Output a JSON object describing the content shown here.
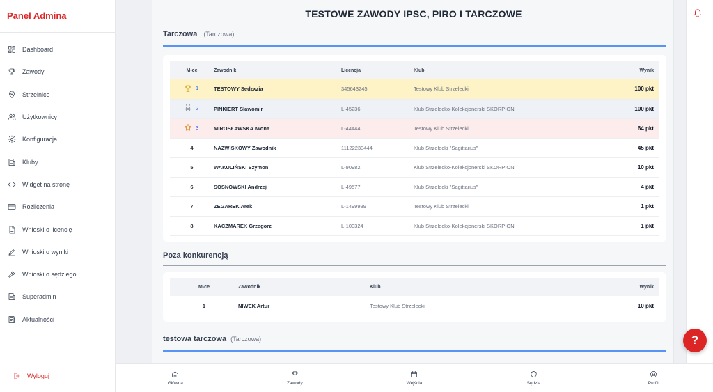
{
  "sidebar": {
    "brand": "Panel Admina",
    "items": [
      {
        "label": "Dashboard",
        "icon": "dashboard-icon"
      },
      {
        "label": "Zawody",
        "icon": "trophy-icon"
      },
      {
        "label": "Strzelnice",
        "icon": "map-pin-icon"
      },
      {
        "label": "Użytkownicy",
        "icon": "users-icon"
      },
      {
        "label": "Konfiguracja",
        "icon": "gear-icon"
      },
      {
        "label": "Kluby",
        "icon": "building-icon"
      },
      {
        "label": "Widget na stronę",
        "icon": "code-icon"
      },
      {
        "label": "Rozliczenia",
        "icon": "credit-card-icon"
      },
      {
        "label": "Wnioski o licencję",
        "icon": "document-icon"
      },
      {
        "label": "Wnioski o wyniki",
        "icon": "pencil-icon"
      },
      {
        "label": "Wnioski o sędziego",
        "icon": "gavel-icon"
      },
      {
        "label": "Superadmin",
        "icon": "building-icon"
      },
      {
        "label": "Aktualności",
        "icon": "newspaper-icon"
      }
    ],
    "logout": "Wyloguj"
  },
  "page": {
    "title": "TESTOWE ZAWODY IPSC, PIRO I TARCZOWE"
  },
  "section1": {
    "title": "Tarczowa",
    "subtitle": "(Tarczowa)",
    "headers": {
      "pos": "M-ce",
      "name": "Zawodnik",
      "license": "Licencja",
      "club": "Klub",
      "result": "Wynik"
    },
    "rows": [
      {
        "pos": "1",
        "name": "TESTOWY Sedzxzia",
        "license": "345643245",
        "club": "Testowy Klub Strzelecki",
        "result": "100 pkt"
      },
      {
        "pos": "2",
        "name": "PINKIERT Sławomir",
        "license": "L-45236",
        "club": "Klub Strzelecko-Kolekcjonerski SKORPION",
        "result": "100 pkt"
      },
      {
        "pos": "3",
        "name": "MIROSŁAWSKA Iwona",
        "license": "L-44444",
        "club": "Testowy Klub Strzelecki",
        "result": "64 pkt"
      },
      {
        "pos": "4",
        "name": "NAZWISKOWY Zawodnik",
        "license": "11122233444",
        "club": "Klub Strzelecki \"Sagittarius\"",
        "result": "45 pkt"
      },
      {
        "pos": "5",
        "name": "WAKULIŃSKI Szymon",
        "license": "L-90982",
        "club": "Klub Strzelecko-Kolekcjonerski SKORPION",
        "result": "10 pkt"
      },
      {
        "pos": "6",
        "name": "SOSNOWSKI Andrzej",
        "license": "L-49577",
        "club": "Klub Strzelecki \"Sagittarius\"",
        "result": "4 pkt"
      },
      {
        "pos": "7",
        "name": "ZEGAREK Arek",
        "license": "L-1499999",
        "club": "Testowy Klub Strzelecki",
        "result": "1 pkt"
      },
      {
        "pos": "8",
        "name": "KACZMAREK Grzegorz",
        "license": "L-100324",
        "club": "Klub Strzelecko-Kolekcjonerski SKORPION",
        "result": "1 pkt"
      }
    ]
  },
  "section2": {
    "title": "Poza konkurencją",
    "headers": {
      "pos": "M-ce",
      "name": "Zawodnik",
      "club": "Klub",
      "result": "Wynik"
    },
    "rows": [
      {
        "pos": "1",
        "name": "NIWEK Artur",
        "club": "Testowy Klub Strzelecki",
        "result": "10 pkt"
      }
    ]
  },
  "section3": {
    "title": "testowa tarczowa",
    "subtitle": "(Tarczowa)"
  },
  "bottom_nav": [
    {
      "label": "Główna",
      "icon": "home-icon"
    },
    {
      "label": "Zawody",
      "icon": "trophy-icon"
    },
    {
      "label": "Wejścia",
      "icon": "calendar-icon"
    },
    {
      "label": "Sędzia",
      "icon": "shield-icon"
    },
    {
      "label": "Profil",
      "icon": "user-circle-icon"
    }
  ],
  "help": {
    "label": "?"
  },
  "colors": {
    "accent": "#dc2626",
    "link": "#2563eb",
    "gold": "#fdf3c6",
    "silver": "#eef1f5",
    "bronze": "#fdecec"
  }
}
